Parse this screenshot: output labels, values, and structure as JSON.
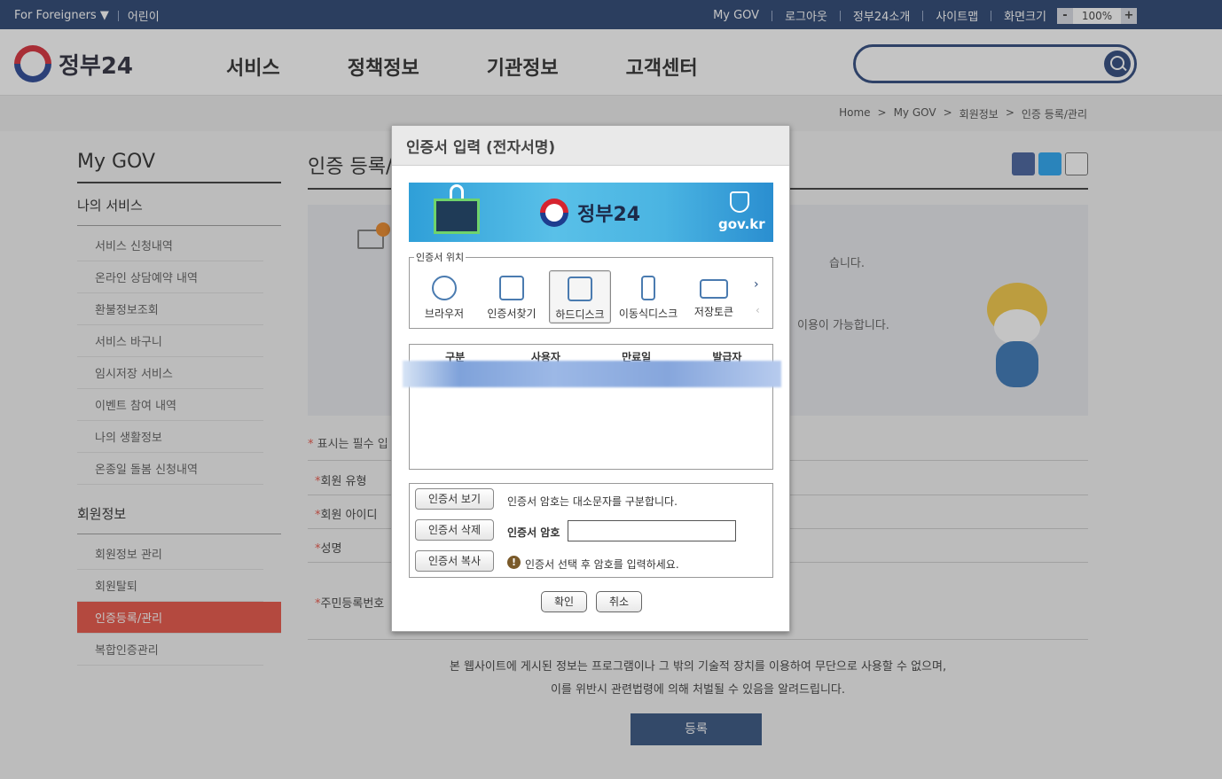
{
  "topbar": {
    "foreigners": "For Foreigners ▼",
    "kids": "어린이",
    "links": [
      "My GOV",
      "로그아웃",
      "정부24소개",
      "사이트맵",
      "화면크기"
    ],
    "zoom_minus": "-",
    "zoom_value": "100%",
    "zoom_plus": "+"
  },
  "header": {
    "logo": "정부24",
    "nav": [
      "서비스",
      "정책정보",
      "기관정보",
      "고객센터"
    ],
    "search_placeholder": ""
  },
  "breadcrumb": [
    "Home",
    ">",
    "My GOV",
    ">",
    "회원정보",
    ">",
    "인증 등록/관리"
  ],
  "lnb": {
    "title": "My GOV",
    "section1": "나의 서비스",
    "items1": [
      "서비스 신청내역",
      "온라인 상담예약 내역",
      "환불정보조회",
      "서비스 바구니",
      "임시저장 서비스",
      "이벤트 참여 내역",
      "나의 생활정보",
      "온종일 돌봄 신청내역"
    ],
    "section2": "회원정보",
    "items2": [
      "회원정보 관리",
      "회원탈퇴",
      "인증등록/관리",
      "복합인증관리"
    ]
  },
  "main": {
    "title": "인증 등록/",
    "info1": "습니다.",
    "info2": "이용이 가능합니다.",
    "required": "표시는 필수 입",
    "fields": [
      "회원 유형",
      "회원 아이디",
      "성명",
      "주민등록번호"
    ],
    "notice1": "본 웹사이트에 게시된 정보는 프로그램이나 그 밖의 기술적 장치를 이용하여 무단으로 사용할 수 없으며,",
    "notice2": "이를 위반시 관련법령에 의해 처벌될 수 있음을 알려드립니다.",
    "register": "등록"
  },
  "modal": {
    "title": "인증서 입력 (전자서명)",
    "banner_title": "정부24",
    "banner_domain": "gov.kr",
    "location_label": "인증서 위치",
    "locations": [
      "브라우저",
      "인증서찾기",
      "하드디스크",
      "이동식디스크",
      "저장토큰"
    ],
    "columns": [
      "구분",
      "사용자",
      "만료일",
      "발급자"
    ],
    "btn_view": "인증서 보기",
    "btn_delete": "인증서 삭제",
    "btn_copy": "인증서 복사",
    "case_note": "인증서 암호는 대소문자를 구분합니다.",
    "pw_label": "인증서 암호",
    "pw_value": "",
    "warning": "인증서 선택 후 암호를 입력하세요.",
    "ok": "확인",
    "cancel": "취소"
  }
}
